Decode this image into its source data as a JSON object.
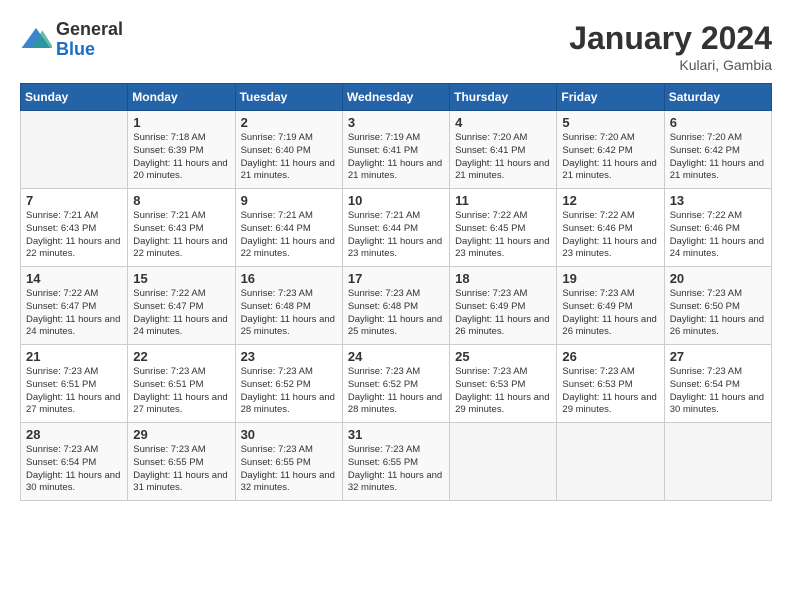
{
  "logo": {
    "general": "General",
    "blue": "Blue"
  },
  "title": "January 2024",
  "location": "Kulari, Gambia",
  "days_of_week": [
    "Sunday",
    "Monday",
    "Tuesday",
    "Wednesday",
    "Thursday",
    "Friday",
    "Saturday"
  ],
  "weeks": [
    [
      {
        "day": "",
        "sunrise": "",
        "sunset": "",
        "daylight": ""
      },
      {
        "day": "1",
        "sunrise": "Sunrise: 7:18 AM",
        "sunset": "Sunset: 6:39 PM",
        "daylight": "Daylight: 11 hours and 20 minutes."
      },
      {
        "day": "2",
        "sunrise": "Sunrise: 7:19 AM",
        "sunset": "Sunset: 6:40 PM",
        "daylight": "Daylight: 11 hours and 21 minutes."
      },
      {
        "day": "3",
        "sunrise": "Sunrise: 7:19 AM",
        "sunset": "Sunset: 6:41 PM",
        "daylight": "Daylight: 11 hours and 21 minutes."
      },
      {
        "day": "4",
        "sunrise": "Sunrise: 7:20 AM",
        "sunset": "Sunset: 6:41 PM",
        "daylight": "Daylight: 11 hours and 21 minutes."
      },
      {
        "day": "5",
        "sunrise": "Sunrise: 7:20 AM",
        "sunset": "Sunset: 6:42 PM",
        "daylight": "Daylight: 11 hours and 21 minutes."
      },
      {
        "day": "6",
        "sunrise": "Sunrise: 7:20 AM",
        "sunset": "Sunset: 6:42 PM",
        "daylight": "Daylight: 11 hours and 21 minutes."
      }
    ],
    [
      {
        "day": "7",
        "sunrise": "Sunrise: 7:21 AM",
        "sunset": "Sunset: 6:43 PM",
        "daylight": "Daylight: 11 hours and 22 minutes."
      },
      {
        "day": "8",
        "sunrise": "Sunrise: 7:21 AM",
        "sunset": "Sunset: 6:43 PM",
        "daylight": "Daylight: 11 hours and 22 minutes."
      },
      {
        "day": "9",
        "sunrise": "Sunrise: 7:21 AM",
        "sunset": "Sunset: 6:44 PM",
        "daylight": "Daylight: 11 hours and 22 minutes."
      },
      {
        "day": "10",
        "sunrise": "Sunrise: 7:21 AM",
        "sunset": "Sunset: 6:44 PM",
        "daylight": "Daylight: 11 hours and 23 minutes."
      },
      {
        "day": "11",
        "sunrise": "Sunrise: 7:22 AM",
        "sunset": "Sunset: 6:45 PM",
        "daylight": "Daylight: 11 hours and 23 minutes."
      },
      {
        "day": "12",
        "sunrise": "Sunrise: 7:22 AM",
        "sunset": "Sunset: 6:46 PM",
        "daylight": "Daylight: 11 hours and 23 minutes."
      },
      {
        "day": "13",
        "sunrise": "Sunrise: 7:22 AM",
        "sunset": "Sunset: 6:46 PM",
        "daylight": "Daylight: 11 hours and 24 minutes."
      }
    ],
    [
      {
        "day": "14",
        "sunrise": "Sunrise: 7:22 AM",
        "sunset": "Sunset: 6:47 PM",
        "daylight": "Daylight: 11 hours and 24 minutes."
      },
      {
        "day": "15",
        "sunrise": "Sunrise: 7:22 AM",
        "sunset": "Sunset: 6:47 PM",
        "daylight": "Daylight: 11 hours and 24 minutes."
      },
      {
        "day": "16",
        "sunrise": "Sunrise: 7:23 AM",
        "sunset": "Sunset: 6:48 PM",
        "daylight": "Daylight: 11 hours and 25 minutes."
      },
      {
        "day": "17",
        "sunrise": "Sunrise: 7:23 AM",
        "sunset": "Sunset: 6:48 PM",
        "daylight": "Daylight: 11 hours and 25 minutes."
      },
      {
        "day": "18",
        "sunrise": "Sunrise: 7:23 AM",
        "sunset": "Sunset: 6:49 PM",
        "daylight": "Daylight: 11 hours and 26 minutes."
      },
      {
        "day": "19",
        "sunrise": "Sunrise: 7:23 AM",
        "sunset": "Sunset: 6:49 PM",
        "daylight": "Daylight: 11 hours and 26 minutes."
      },
      {
        "day": "20",
        "sunrise": "Sunrise: 7:23 AM",
        "sunset": "Sunset: 6:50 PM",
        "daylight": "Daylight: 11 hours and 26 minutes."
      }
    ],
    [
      {
        "day": "21",
        "sunrise": "Sunrise: 7:23 AM",
        "sunset": "Sunset: 6:51 PM",
        "daylight": "Daylight: 11 hours and 27 minutes."
      },
      {
        "day": "22",
        "sunrise": "Sunrise: 7:23 AM",
        "sunset": "Sunset: 6:51 PM",
        "daylight": "Daylight: 11 hours and 27 minutes."
      },
      {
        "day": "23",
        "sunrise": "Sunrise: 7:23 AM",
        "sunset": "Sunset: 6:52 PM",
        "daylight": "Daylight: 11 hours and 28 minutes."
      },
      {
        "day": "24",
        "sunrise": "Sunrise: 7:23 AM",
        "sunset": "Sunset: 6:52 PM",
        "daylight": "Daylight: 11 hours and 28 minutes."
      },
      {
        "day": "25",
        "sunrise": "Sunrise: 7:23 AM",
        "sunset": "Sunset: 6:53 PM",
        "daylight": "Daylight: 11 hours and 29 minutes."
      },
      {
        "day": "26",
        "sunrise": "Sunrise: 7:23 AM",
        "sunset": "Sunset: 6:53 PM",
        "daylight": "Daylight: 11 hours and 29 minutes."
      },
      {
        "day": "27",
        "sunrise": "Sunrise: 7:23 AM",
        "sunset": "Sunset: 6:54 PM",
        "daylight": "Daylight: 11 hours and 30 minutes."
      }
    ],
    [
      {
        "day": "28",
        "sunrise": "Sunrise: 7:23 AM",
        "sunset": "Sunset: 6:54 PM",
        "daylight": "Daylight: 11 hours and 30 minutes."
      },
      {
        "day": "29",
        "sunrise": "Sunrise: 7:23 AM",
        "sunset": "Sunset: 6:55 PM",
        "daylight": "Daylight: 11 hours and 31 minutes."
      },
      {
        "day": "30",
        "sunrise": "Sunrise: 7:23 AM",
        "sunset": "Sunset: 6:55 PM",
        "daylight": "Daylight: 11 hours and 32 minutes."
      },
      {
        "day": "31",
        "sunrise": "Sunrise: 7:23 AM",
        "sunset": "Sunset: 6:55 PM",
        "daylight": "Daylight: 11 hours and 32 minutes."
      },
      {
        "day": "",
        "sunrise": "",
        "sunset": "",
        "daylight": ""
      },
      {
        "day": "",
        "sunrise": "",
        "sunset": "",
        "daylight": ""
      },
      {
        "day": "",
        "sunrise": "",
        "sunset": "",
        "daylight": ""
      }
    ]
  ]
}
